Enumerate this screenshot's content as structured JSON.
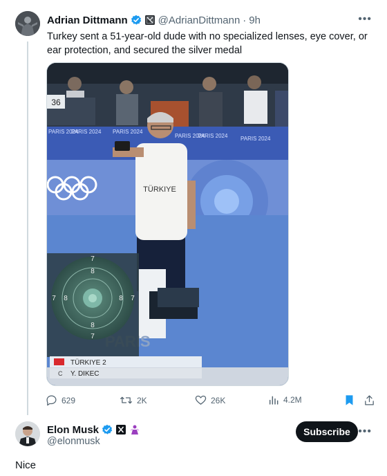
{
  "tweet": {
    "author_name": "Adrian Dittmann",
    "author_handle": "@AdrianDittmann",
    "separator": "·",
    "time": "9h",
    "text": "Turkey sent a 51-year-old dude with no specialized lenses, eye cover, or ear protection, and secured the silver medal",
    "image": {
      "banner_text": "PARIS 2024",
      "lane_number": "36",
      "shirt_text": "TÜRKIYE",
      "big_letters": "PARIS",
      "target_rings": [
        "7",
        "8",
        "8",
        "7",
        "7",
        "8",
        "8",
        "7"
      ],
      "score_row1": "TÜRKIYE 2",
      "score_row2_prefix": "C",
      "score_row2_name": "Y. DIKEC"
    },
    "actions": {
      "replies": "629",
      "reposts": "2K",
      "likes": "26K",
      "views": "4.2M"
    }
  },
  "reply": {
    "author_name": "Elon Musk",
    "author_handle": "@elonmusk",
    "subscribe_label": "Subscribe",
    "text": "Nice"
  },
  "icons": {
    "verified": "verified-badge-icon",
    "more": "more-icon",
    "reply": "reply-icon",
    "repost": "repost-icon",
    "like": "heart-icon",
    "views": "views-icon",
    "bookmark": "bookmark-icon",
    "share": "share-icon"
  },
  "colors": {
    "verified": "#1d9bf0",
    "bookmark": "#1d9bf0",
    "muted": "#536471",
    "subscribe_bg": "#0f1419"
  }
}
